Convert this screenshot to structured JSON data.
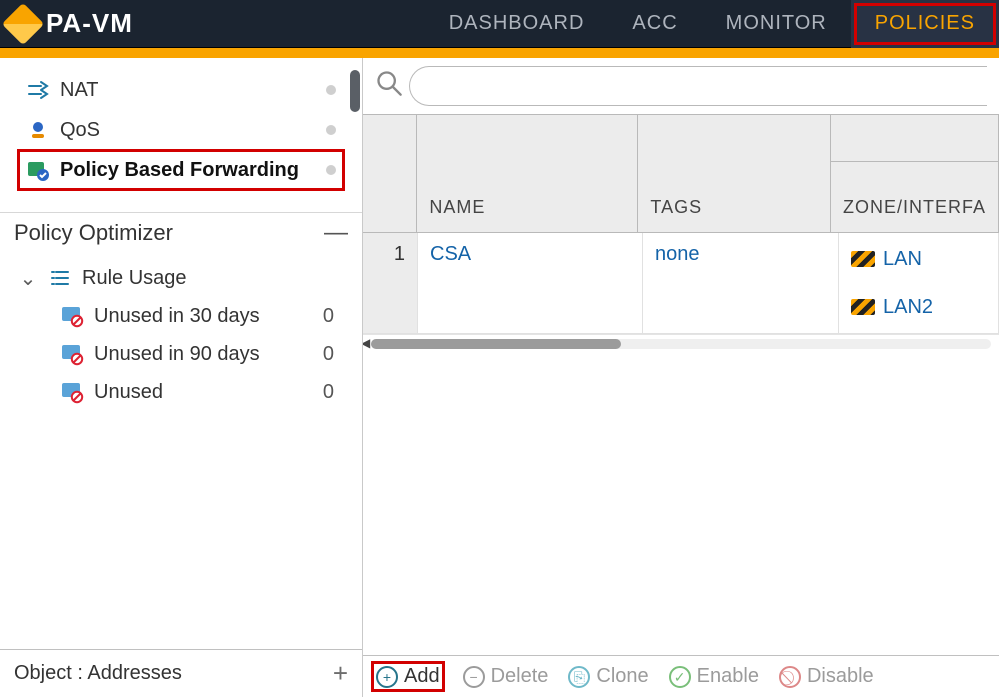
{
  "brand": "PA-VM",
  "topnav": {
    "dashboard": "DASHBOARD",
    "acc": "ACC",
    "monitor": "MONITOR",
    "policies": "POLICIES"
  },
  "sidebar": {
    "policy_types": {
      "nat": "NAT",
      "qos": "QoS",
      "pbf": "Policy Based Forwarding"
    },
    "optimizer": {
      "title": "Policy Optimizer",
      "rule_usage_label": "Rule Usage",
      "unused30": {
        "label": "Unused in 30 days",
        "count": "0"
      },
      "unused90": {
        "label": "Unused in 90 days",
        "count": "0"
      },
      "unused": {
        "label": "Unused",
        "count": "0"
      }
    },
    "footer": "Object : Addresses"
  },
  "search": {
    "placeholder": ""
  },
  "grid": {
    "columns": {
      "name": "NAME",
      "tags": "TAGS",
      "zone": "ZONE/INTERFA"
    },
    "rows": [
      {
        "index": "1",
        "name": "CSA",
        "tags": "none",
        "zones": [
          "LAN",
          "LAN2"
        ]
      }
    ]
  },
  "actionbar": {
    "add": "Add",
    "delete": "Delete",
    "clone": "Clone",
    "enable": "Enable",
    "disable": "Disable"
  }
}
